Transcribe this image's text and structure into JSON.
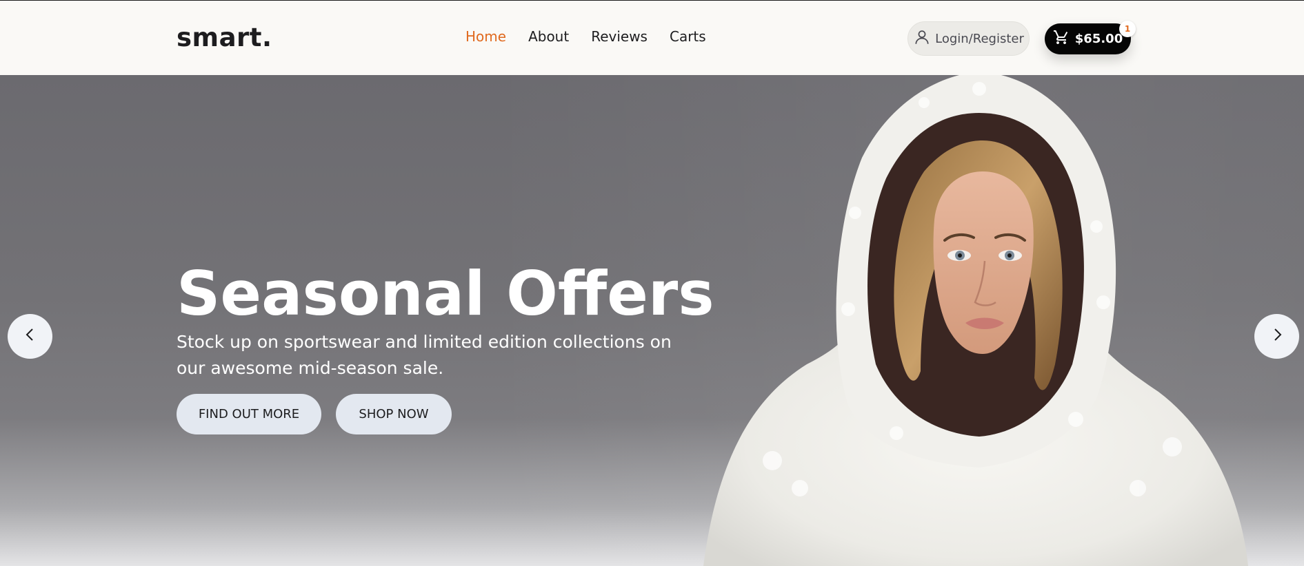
{
  "brand": {
    "logo": "smart."
  },
  "nav": {
    "items": [
      {
        "label": "Home",
        "active": true
      },
      {
        "label": "About",
        "active": false
      },
      {
        "label": "Reviews",
        "active": false
      },
      {
        "label": "Carts",
        "active": false
      }
    ]
  },
  "account": {
    "login_label": "Login/Register",
    "icon": "user-icon"
  },
  "cart": {
    "total": "$65.00",
    "count": "1",
    "icon": "cart-icon"
  },
  "hero": {
    "title": "Seasonal Offers",
    "subtitle": "Stock up on sportswear and limited edition collections on our awesome mid-season sale.",
    "primary_button": "FIND OUT MORE",
    "secondary_button": "SHOP NOW",
    "prev_icon": "chevron-left-icon",
    "next_icon": "chevron-right-icon"
  },
  "colors": {
    "accent": "#e06a1f",
    "header_bg": "#faf9f6",
    "cart_bg": "#050505",
    "button_bg": "#e3e8f0"
  }
}
